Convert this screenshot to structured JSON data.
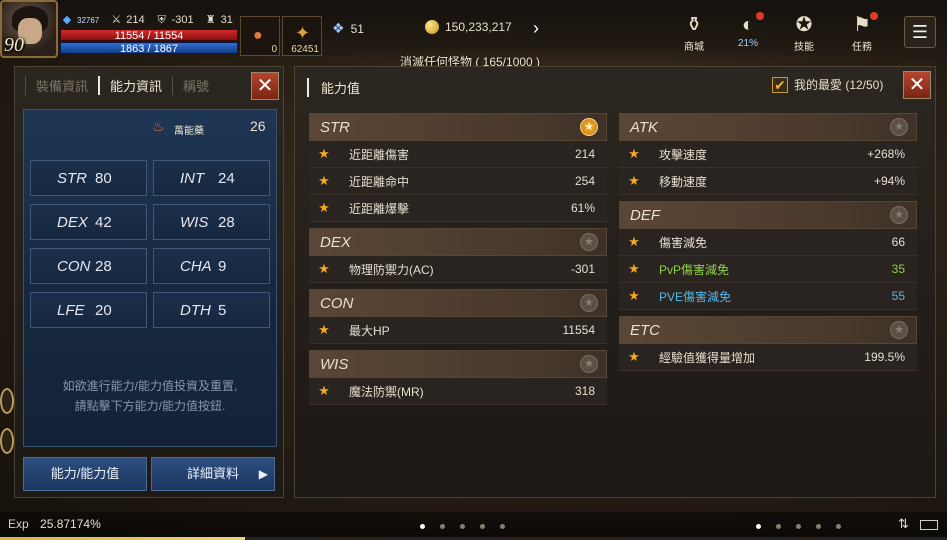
{
  "hud": {
    "level": "90",
    "power": "32767",
    "stat_a": "214",
    "stat_b": "-301",
    "stat_c": "31",
    "hp": "11554 / 11554",
    "mp": "1863 / 1867",
    "slot1_count": "0",
    "slot2_count": "62451",
    "crystal": "51",
    "gold": "150,233,217",
    "quest_text": "消滅任何怪物 ( 165/1000 )",
    "menu": [
      {
        "label": "商城",
        "icon": "shop-icon"
      },
      {
        "label": "21%",
        "icon": "bag-icon"
      },
      {
        "label": "技能",
        "icon": "skill-icon"
      },
      {
        "label": "任務",
        "icon": "quest-icon"
      }
    ]
  },
  "left_panel": {
    "tabs": [
      "裝備資訊",
      "能力資訊",
      "稱號"
    ],
    "active_tab": 1,
    "potion_label": "萬能藥",
    "potion_value": "26",
    "stats": [
      {
        "name": "STR",
        "value": "80"
      },
      {
        "name": "INT",
        "value": "24"
      },
      {
        "name": "DEX",
        "value": "42"
      },
      {
        "name": "WIS",
        "value": "28"
      },
      {
        "name": "CON",
        "value": "28"
      },
      {
        "name": "CHA",
        "value": "9"
      },
      {
        "name": "LFE",
        "value": "20"
      },
      {
        "name": "DTH",
        "value": "5"
      }
    ],
    "hint_line1": "如欲進行能力/能力值投資及重置,",
    "hint_line2": "請點擊下方能力/能力值按鈕.",
    "button_ability": "能力/能力值",
    "button_detail": "詳細資料"
  },
  "right_panel": {
    "title": "能力值",
    "favorite_label": "我的最愛 (12/50)",
    "left_sections": [
      {
        "name": "STR",
        "fav": true,
        "rows": [
          {
            "label": "近距離傷害",
            "value": "214",
            "color": ""
          },
          {
            "label": "近距離命中",
            "value": "254",
            "color": ""
          },
          {
            "label": "近距離爆擊",
            "value": "61%",
            "color": ""
          }
        ]
      },
      {
        "name": "DEX",
        "fav": false,
        "rows": [
          {
            "label": "物理防禦力(AC)",
            "value": "-301",
            "color": ""
          }
        ]
      },
      {
        "name": "CON",
        "fav": false,
        "rows": [
          {
            "label": "最大HP",
            "value": "11554",
            "color": ""
          }
        ]
      },
      {
        "name": "WIS",
        "fav": false,
        "rows": [
          {
            "label": "魔法防禦(MR)",
            "value": "318",
            "color": ""
          }
        ]
      }
    ],
    "right_sections": [
      {
        "name": "ATK",
        "fav": false,
        "rows": [
          {
            "label": "攻擊速度",
            "value": "+268%",
            "color": ""
          },
          {
            "label": "移動速度",
            "value": "+94%",
            "color": ""
          }
        ]
      },
      {
        "name": "DEF",
        "fav": false,
        "rows": [
          {
            "label": "傷害減免",
            "value": "66",
            "color": ""
          },
          {
            "label": "PvP傷害減免",
            "value": "35",
            "color": "green"
          },
          {
            "label": "PVE傷害減免",
            "value": "55",
            "color": "cyan"
          }
        ]
      },
      {
        "name": "ETC",
        "fav": false,
        "rows": [
          {
            "label": "經驗值獲得量增加",
            "value": "199.5%",
            "color": ""
          }
        ]
      }
    ]
  },
  "bottom": {
    "exp_label": "Exp",
    "exp_value": "25.87174%",
    "exp_fraction": 0.2587
  },
  "colors": {
    "accent_gold": "#f5a820",
    "close_red": "#b5462f",
    "panel_blue": "#1e3654",
    "pvp_green": "#8ed04a",
    "pve_cyan": "#4fb8e8"
  }
}
